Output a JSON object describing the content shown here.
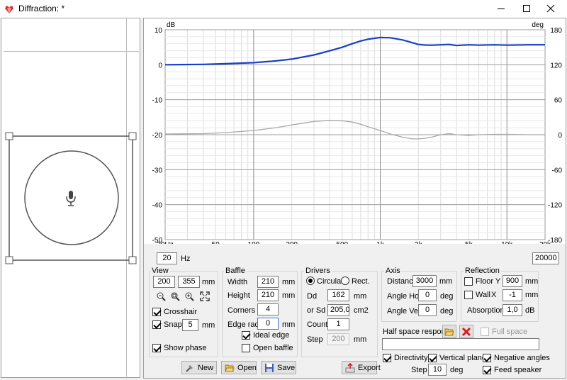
{
  "window": {
    "title": "Diffraction: *",
    "minimize_icon": "minimize-icon",
    "maximize_icon": "maximize-icon",
    "close_icon": "close-icon"
  },
  "chart_data": {
    "type": "line",
    "x_scale": "log",
    "x_range": [
      20,
      20000
    ],
    "x_ticks": [
      20,
      50,
      100,
      200,
      500,
      1000,
      2000,
      5000,
      10000,
      20000
    ],
    "x_tick_labels": [
      "20Hz",
      "50",
      "100",
      "200",
      "500",
      "1k",
      "2k",
      "5k",
      "10k",
      "20k"
    ],
    "y_left_unit": "dB",
    "y_left_range": [
      -50,
      10
    ],
    "y_left_ticks": [
      10,
      0,
      -10,
      -20,
      -30,
      -40,
      -50
    ],
    "y_right_unit": "deg",
    "y_right_range": [
      -180,
      180
    ],
    "y_right_ticks": [
      180,
      120,
      60,
      0,
      -60,
      -120,
      -180
    ],
    "grid": true,
    "series": [
      {
        "color": "#1a3fc7",
        "x": [
          20,
          40,
          60,
          100,
          150,
          200,
          300,
          400,
          500,
          600,
          700,
          800,
          1000,
          1200,
          1500,
          1800,
          2000,
          2300,
          2600,
          3000,
          3500,
          4000,
          5000,
          6000,
          8000,
          10000,
          15000,
          20000
        ],
        "y": [
          0,
          0.1,
          0.3,
          0.6,
          1.1,
          1.6,
          2.8,
          4.0,
          5.0,
          6.0,
          6.8,
          7.3,
          7.8,
          7.7,
          7.1,
          6.3,
          5.8,
          5.6,
          5.6,
          5.7,
          5.8,
          5.5,
          5.7,
          5.6,
          5.7,
          5.6,
          5.7,
          5.7
        ]
      },
      {
        "color": "#a8a8a8",
        "x": [
          20,
          40,
          60,
          100,
          150,
          200,
          300,
          400,
          500,
          600,
          700,
          800,
          1000,
          1200,
          1500,
          1800,
          2000,
          2300,
          2600,
          3000,
          3500,
          4000,
          5000,
          6000,
          8000,
          10000,
          15000,
          20000
        ],
        "y": [
          -19.8,
          -19.7,
          -19.4,
          -18.8,
          -18.0,
          -17.2,
          -16.2,
          -15.9,
          -16.0,
          -16.4,
          -17.0,
          -17.7,
          -18.8,
          -19.8,
          -20.7,
          -21.2,
          -21.2,
          -21.0,
          -20.6,
          -20.0,
          -19.7,
          -20.0,
          -20.2,
          -20.0,
          -19.9,
          -19.9,
          -20.0,
          -20.0
        ]
      }
    ]
  },
  "freq": {
    "min": "20",
    "unit": "Hz",
    "max": "20000"
  },
  "view": {
    "title": "View",
    "size_w": "200",
    "size_h": "355",
    "unit": "mm",
    "crosshair": "Crosshair",
    "snap": "Snap",
    "snap_value": "5",
    "snap_unit": "mm",
    "show_phase": "Show phase"
  },
  "baffle": {
    "title": "Baffle",
    "width_label": "Width",
    "width": "210",
    "height_label": "Height",
    "height": "210",
    "corners_label": "Corners",
    "corners": "4",
    "edge_label": "Edge rad.",
    "edge": "0",
    "unit": "mm",
    "ideal_edge": "Ideal edge",
    "open_baffle": "Open baffle"
  },
  "drivers": {
    "title": "Drivers",
    "circular": "Circular",
    "rect": "Rect.",
    "dd_label": "Dd",
    "dd": "162",
    "dd_unit": "mm",
    "sd_label": "or Sd",
    "sd": "205,0",
    "sd_unit": "cm2",
    "count_label": "Count",
    "count": "1",
    "step_label": "Step",
    "step": "200",
    "step_unit": "mm"
  },
  "axis": {
    "title": "Axis",
    "distance_label": "Distance",
    "distance": "3000",
    "distance_unit": "mm",
    "hor_label": "Angle Hor",
    "hor": "0",
    "hor_unit": "deg",
    "ver_label": "Angle Ver",
    "ver": "0",
    "ver_unit": "deg"
  },
  "reflection": {
    "title": "Reflection",
    "floor": "Floor Y",
    "floor_value": "900",
    "floor_unit": "mm",
    "wall": "Wall",
    "wall_axis": "X",
    "wall_value": "-1",
    "wall_unit": "mm",
    "absorption_label": "Absorption",
    "absorption": "1,0",
    "absorption_unit": "dB"
  },
  "half_space": {
    "label": "Half space response",
    "full_space": "Full space",
    "file_value": ""
  },
  "options": {
    "directivity": "Directivity",
    "vertical_plane": "Vertical plane",
    "negative_angles": "Negative angles",
    "step_label": "Step",
    "step": "10",
    "step_unit": "deg",
    "feed_speaker": "Feed speaker"
  },
  "buttons": {
    "new": "New",
    "open": "Open",
    "save": "Save",
    "export": "Export"
  }
}
